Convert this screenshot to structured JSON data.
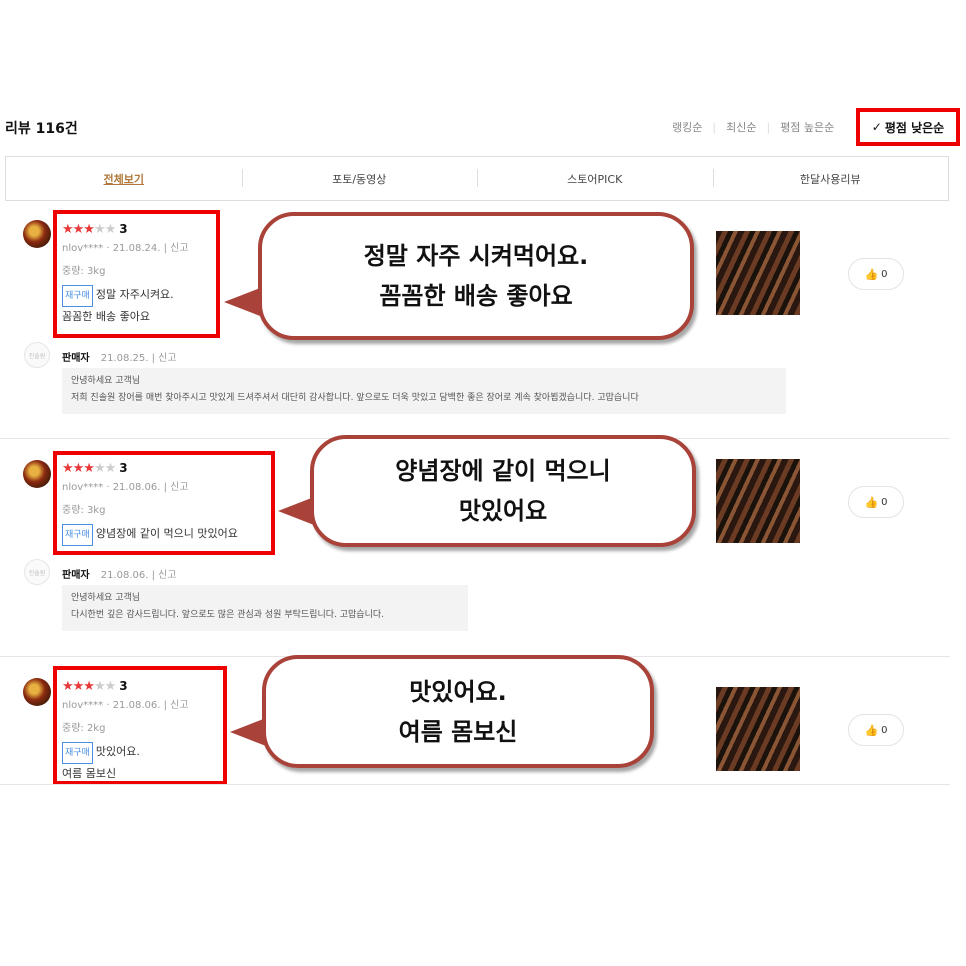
{
  "header": {
    "title": "리뷰 116건"
  },
  "sort": {
    "options": [
      "랭킹순",
      "최신순",
      "평점 높은순"
    ],
    "active": "평점 낮은순"
  },
  "tabs": [
    "전체보기",
    "포토/동영상",
    "스토어PICK",
    "한달사용리뷰"
  ],
  "reviews": [
    {
      "rating": 3,
      "score": "3",
      "meta": "nlov**** · 21.08.24. | 신고",
      "weight": "중량: 3kg",
      "badge": "재구매",
      "text_line1": "정말 자주시켜요.",
      "text_line2": "꼼꼼한 배송 좋아요",
      "bubble_line1": "정말 자주 시켜먹어요.",
      "bubble_line2": "꼼꼼한 배송 좋아요",
      "likes": "0",
      "seller": {
        "name": "판매자",
        "meta": "21.08.25. | 신고",
        "reply_line1": "안녕하세요 고객님",
        "reply_line2": "저희 진솔원 장어를 매번 찾아주시고 맛있게 드셔주셔서 대단히 감사합니다. 앞으로도 더욱 맛있고 담백한 좋은 장어로 계속 찾아뵙겠습니다. 고맙습니다"
      }
    },
    {
      "rating": 3,
      "score": "3",
      "meta": "nlov**** · 21.08.06. | 신고",
      "weight": "중량: 3kg",
      "badge": "재구매",
      "text_line1": "양념장에 같이 먹으니 맛있어요",
      "text_line2": "",
      "bubble_line1": "양념장에 같이 먹으니",
      "bubble_line2": "맛있어요",
      "likes": "0",
      "seller": {
        "name": "판매자",
        "meta": "21.08.06. | 신고",
        "reply_line1": "안녕하세요 고객님",
        "reply_line2": "다시한번 깊은 감사드립니다. 앞으로도 많은 관심과 성원 부탁드립니다. 고맙습니다."
      }
    },
    {
      "rating": 3,
      "score": "3",
      "meta": "nlov**** · 21.08.06. | 신고",
      "weight": "중량: 2kg",
      "badge": "재구매",
      "text_line1": "맛있어요.",
      "text_line2": "여름 몸보신",
      "bubble_line1": "맛있어요.",
      "bubble_line2": "여름 몸보신",
      "likes": "0"
    }
  ],
  "icons": {
    "check": "check-icon",
    "thumb": "thumbs-up-icon",
    "star": "star-icon"
  },
  "colors": {
    "highlight": "#ee0000",
    "bubble_border": "#a9433a",
    "star": "#e8383a",
    "tab_active": "#b0793b"
  }
}
